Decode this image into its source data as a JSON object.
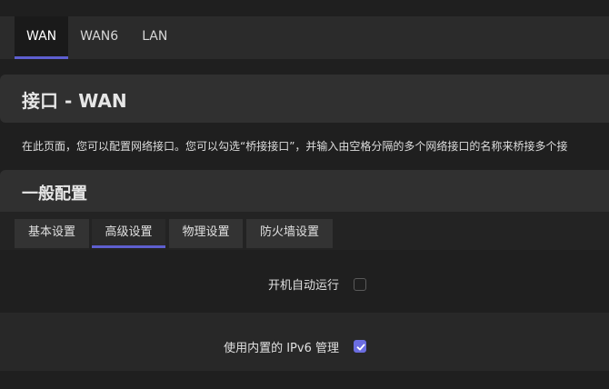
{
  "top_tabs": [
    {
      "label": "WAN",
      "active": true
    },
    {
      "label": "WAN6",
      "active": false
    },
    {
      "label": "LAN",
      "active": false
    }
  ],
  "page_title": "接口 - WAN",
  "description": "在此页面，您可以配置网络接口。您可以勾选“桥接接口”，并输入由空格分隔的多个网络接口的名称来桥接多个接",
  "section_title": "一般配置",
  "sub_tabs": [
    {
      "label": "基本设置",
      "active": false
    },
    {
      "label": "高级设置",
      "active": true
    },
    {
      "label": "物理设置",
      "active": false
    },
    {
      "label": "防火墙设置",
      "active": false
    }
  ],
  "options": [
    {
      "label": "开机自动运行",
      "checked": false
    },
    {
      "label": "使用内置的 IPv6 管理",
      "checked": true
    }
  ],
  "colors": {
    "accent": "#5e5fd0",
    "checkbox_checked": "#6b6de0",
    "background": "#1f1f1f",
    "panel": "#303030"
  },
  "icons": {
    "checkmark": "check-icon"
  }
}
